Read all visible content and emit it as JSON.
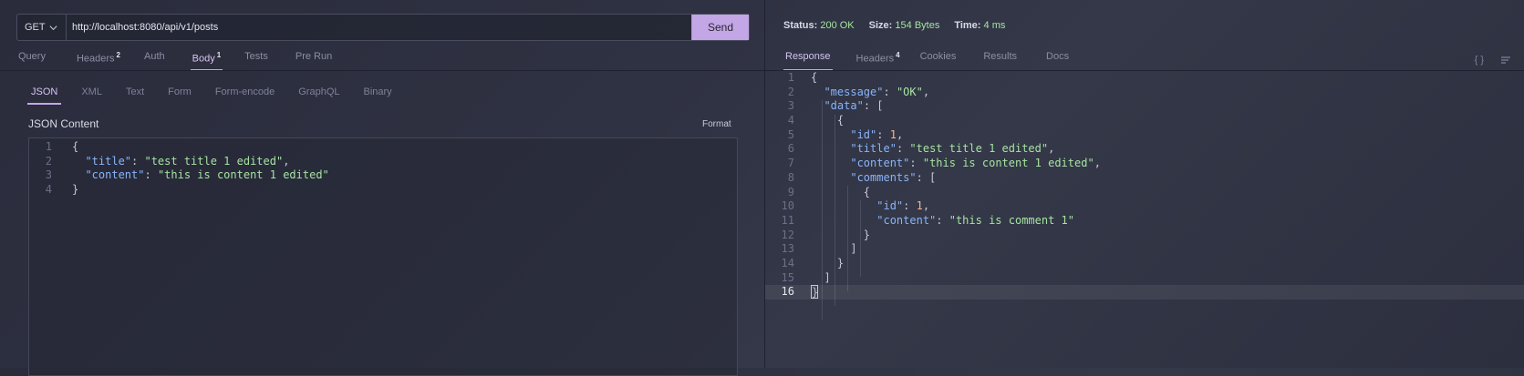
{
  "request": {
    "method": "GET",
    "url": "http://localhost:8080/api/v1/posts",
    "send_label": "Send",
    "tabs": [
      {
        "label": "Query",
        "badge": ""
      },
      {
        "label": "Headers",
        "badge": "2"
      },
      {
        "label": "Auth",
        "badge": ""
      },
      {
        "label": "Body",
        "badge": "1"
      },
      {
        "label": "Tests",
        "badge": ""
      },
      {
        "label": "Pre Run",
        "badge": ""
      }
    ],
    "active_tab": "Body",
    "body_types": [
      "JSON",
      "XML",
      "Text",
      "Form",
      "Form-encode",
      "GraphQL",
      "Binary"
    ],
    "active_body_type": "JSON",
    "content_label": "JSON Content",
    "format_label": "Format",
    "body_lines": [
      "1",
      "2",
      "3",
      "4"
    ],
    "body": {
      "title_key": "\"title\"",
      "title_val": "\"test title 1 edited\"",
      "content_key": "\"content\"",
      "content_val": "\"this is content 1 edited\""
    }
  },
  "response": {
    "status_label": "Status:",
    "status_value": "200 OK",
    "size_label": "Size:",
    "size_value": "154 Bytes",
    "time_label": "Time:",
    "time_value": "4 ms",
    "tabs": [
      {
        "label": "Response",
        "badge": ""
      },
      {
        "label": "Headers",
        "badge": "4"
      },
      {
        "label": "Cookies",
        "badge": ""
      },
      {
        "label": "Results",
        "badge": ""
      },
      {
        "label": "Docs",
        "badge": ""
      }
    ],
    "active_tab": "Response",
    "json": {
      "message_val": "\"OK\"",
      "id_val": "1",
      "title_val": "\"test title 1 edited\"",
      "content_val": "\"this is content 1 edited\"",
      "comment_id_val": "1",
      "comment_content_val": "\"this is comment 1\""
    },
    "line_numbers": [
      "1",
      "2",
      "3",
      "4",
      "5",
      "6",
      "7",
      "8",
      "9",
      "10",
      "11",
      "12",
      "13",
      "14",
      "15",
      "16"
    ]
  },
  "icons": {
    "method_dropdown": "chevron-down-icon",
    "response_json": "braces-icon",
    "response_wrap": "wrap-lines-icon"
  },
  "colors": {
    "accent": "#c3a6e6",
    "status_ok": "#a6e3a1",
    "json_key": "#89b4fa",
    "json_string": "#a6e3a1",
    "json_number": "#fab387"
  }
}
